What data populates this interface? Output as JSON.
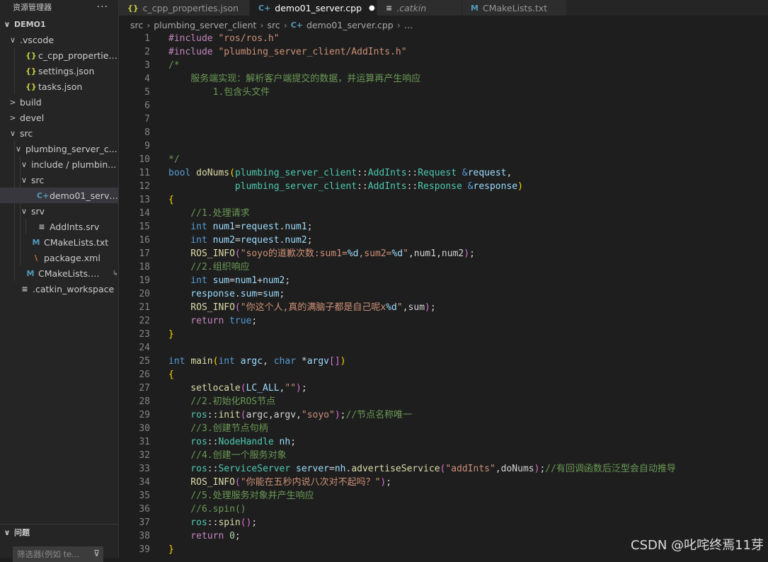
{
  "sidebar": {
    "title": "资源管理器",
    "more": "···",
    "tree": [
      {
        "label": "DEMO1",
        "indent": 0,
        "chev": "∨",
        "icon": "",
        "root": true
      },
      {
        "label": ".vscode",
        "indent": 1,
        "chev": "∨",
        "icon": ""
      },
      {
        "label": "c_cpp_properties.j...",
        "indent": 2,
        "chev": "",
        "icon": "{}",
        "icls": "json"
      },
      {
        "label": "settings.json",
        "indent": 2,
        "chev": "",
        "icon": "{}",
        "icls": "json"
      },
      {
        "label": "tasks.json",
        "indent": 2,
        "chev": "",
        "icon": "{}",
        "icls": "json"
      },
      {
        "label": "build",
        "indent": 1,
        "chev": ">",
        "icon": ""
      },
      {
        "label": "devel",
        "indent": 1,
        "chev": ">",
        "icon": ""
      },
      {
        "label": "src",
        "indent": 1,
        "chev": "∨",
        "icon": ""
      },
      {
        "label": "plumbing_server_c...",
        "indent": 2,
        "chev": "∨",
        "icon": ""
      },
      {
        "label": "include / plumbin...",
        "indent": 3,
        "chev": "∨",
        "icon": ""
      },
      {
        "label": "src",
        "indent": 3,
        "chev": "∨",
        "icon": ""
      },
      {
        "label": "demo01_server....",
        "indent": 4,
        "chev": "",
        "icon": "C+",
        "icls": "cpp",
        "selected": true
      },
      {
        "label": "srv",
        "indent": 3,
        "chev": "∨",
        "icon": ""
      },
      {
        "label": "AddInts.srv",
        "indent": 4,
        "chev": "",
        "icon": "≡",
        "icls": "txt"
      },
      {
        "label": "CMakeLists.txt",
        "indent": 3,
        "chev": "",
        "icon": "M",
        "icls": "m"
      },
      {
        "label": "package.xml",
        "indent": 3,
        "chev": "",
        "icon": "\\",
        "icls": "rss"
      },
      {
        "label": "CMakeLists.txt",
        "indent": 2,
        "chev": "",
        "icon": "M",
        "icls": "m",
        "link": "↳"
      },
      {
        "label": ".catkin_workspace",
        "indent": 1,
        "chev": "",
        "icon": "≡",
        "icls": "txt"
      }
    ]
  },
  "problems": {
    "title": "问题",
    "filter_placeholder": "筛选器(例如 te..."
  },
  "tabs": [
    {
      "label": "c_cpp_properties.json",
      "icon": "{}",
      "icolor": "#cbcb41",
      "active": false,
      "width": 185
    },
    {
      "label": "demo01_server.cpp",
      "icon": "C+",
      "icolor": "#519aba",
      "active": true,
      "modified": true,
      "width": 180
    },
    {
      "label": ".catkin",
      "icon": "≡",
      "icolor": "#c5c5c5",
      "active": false,
      "italic": true,
      "width": 120
    },
    {
      "label": "CMakeLists.txt",
      "icon": "M",
      "icolor": "#519aba",
      "active": false,
      "width": 148
    }
  ],
  "breadcrumb": [
    "src",
    "plumbing_server_client",
    "src",
    "demo01_server.cpp",
    "…"
  ],
  "editor": {
    "lines": [
      [
        [
          "#include ",
          "pre"
        ],
        [
          "\"ros/ros.h\"",
          "str"
        ]
      ],
      [
        [
          "#include ",
          "pre"
        ],
        [
          "\"plumbing_server_client/AddInts.h\"",
          "str"
        ]
      ],
      [
        [
          "/*",
          "com"
        ]
      ],
      [
        [
          "    服务端实现：解析客户端提交的数据，并运算再产生响应",
          "com"
        ]
      ],
      [
        [
          "        1.包含头文件",
          "com"
        ]
      ],
      [],
      [],
      [],
      [],
      [
        [
          "*/",
          "com"
        ]
      ],
      [
        [
          "bool ",
          "kw"
        ],
        [
          "doNums",
          "fn"
        ],
        [
          "(",
          "br"
        ],
        [
          "plumbing_server_client",
          "ty"
        ],
        [
          "::",
          "pl"
        ],
        [
          "AddInts",
          "ty"
        ],
        [
          "::",
          "pl"
        ],
        [
          "Request",
          "ty"
        ],
        [
          " &",
          "kw"
        ],
        [
          "request",
          "var"
        ],
        [
          ",",
          "pl"
        ]
      ],
      [
        [
          "            plumbing_server_client",
          "ty"
        ],
        [
          "::",
          "pl"
        ],
        [
          "AddInts",
          "ty"
        ],
        [
          "::",
          "pl"
        ],
        [
          "Response",
          "ty"
        ],
        [
          " &",
          "kw"
        ],
        [
          "response",
          "var"
        ],
        [
          ")",
          "br"
        ]
      ],
      [
        [
          "{",
          "br"
        ]
      ],
      [
        [
          "    //1.处理请求",
          "com"
        ]
      ],
      [
        [
          "    int ",
          "kw"
        ],
        [
          "num1",
          "var"
        ],
        [
          "=",
          "pl"
        ],
        [
          "request",
          "var"
        ],
        [
          ".",
          "pl"
        ],
        [
          "num1",
          "var"
        ],
        [
          ";",
          "pl"
        ]
      ],
      [
        [
          "    int ",
          "kw"
        ],
        [
          "num2",
          "var"
        ],
        [
          "=",
          "pl"
        ],
        [
          "request",
          "var"
        ],
        [
          ".",
          "pl"
        ],
        [
          "num2",
          "var"
        ],
        [
          ";",
          "pl"
        ]
      ],
      [
        [
          "    ROS_INFO",
          "fn"
        ],
        [
          "(",
          "br2"
        ],
        [
          "\"soyo的道歉次数:sum1=",
          "str"
        ],
        [
          "%d",
          "fmt"
        ],
        [
          ",sum2=",
          "str"
        ],
        [
          "%d",
          "fmt"
        ],
        [
          "\"",
          "str"
        ],
        [
          ",num1,num2",
          "pl"
        ],
        [
          ")",
          "br2"
        ],
        [
          ";",
          "pl"
        ]
      ],
      [
        [
          "    //2.组织响应",
          "com"
        ]
      ],
      [
        [
          "    int ",
          "kw"
        ],
        [
          "sum",
          "var"
        ],
        [
          "=",
          "pl"
        ],
        [
          "num1",
          "var"
        ],
        [
          "+",
          "pl"
        ],
        [
          "num2",
          "var"
        ],
        [
          ";",
          "pl"
        ]
      ],
      [
        [
          "    response",
          "var"
        ],
        [
          ".",
          "pl"
        ],
        [
          "sum",
          "var"
        ],
        [
          "=",
          "pl"
        ],
        [
          "sum",
          "var"
        ],
        [
          ";",
          "pl"
        ]
      ],
      [
        [
          "    ROS_INFO",
          "fn"
        ],
        [
          "(",
          "br2"
        ],
        [
          "\"你这个人,真的满脑子都是自己呢x",
          "str"
        ],
        [
          "%d",
          "fmt"
        ],
        [
          "\"",
          "str"
        ],
        [
          ",sum",
          "pl"
        ],
        [
          ")",
          "br2"
        ],
        [
          ";",
          "pl"
        ]
      ],
      [
        [
          "    return ",
          "pre"
        ],
        [
          "true",
          "kw"
        ],
        [
          ";",
          "pl"
        ]
      ],
      [
        [
          "}",
          "br"
        ]
      ],
      [],
      [
        [
          "int ",
          "kw"
        ],
        [
          "main",
          "fn"
        ],
        [
          "(",
          "br"
        ],
        [
          "int ",
          "kw"
        ],
        [
          "argc",
          "var"
        ],
        [
          ", ",
          "pl"
        ],
        [
          "char ",
          "kw"
        ],
        [
          "*",
          "pl"
        ],
        [
          "argv",
          "var"
        ],
        [
          "[]",
          "br2"
        ],
        [
          ")",
          "br"
        ]
      ],
      [
        [
          "{",
          "br"
        ]
      ],
      [
        [
          "    setlocale",
          "fn"
        ],
        [
          "(",
          "br2"
        ],
        [
          "LC_ALL",
          "var"
        ],
        [
          ",",
          "pl"
        ],
        [
          "\"\"",
          "str"
        ],
        [
          ")",
          "br2"
        ],
        [
          ";",
          "pl"
        ]
      ],
      [
        [
          "    //2.初始化ROS节点",
          "com"
        ]
      ],
      [
        [
          "    ros",
          "ty"
        ],
        [
          "::",
          "pl"
        ],
        [
          "init",
          "fn"
        ],
        [
          "(",
          "br2"
        ],
        [
          "argc,argv,",
          "pl"
        ],
        [
          "\"soyo\"",
          "str"
        ],
        [
          ")",
          "br2"
        ],
        [
          ";",
          "pl"
        ],
        [
          "//节点名称唯一",
          "com"
        ]
      ],
      [
        [
          "    //3.创建节点句柄",
          "com"
        ]
      ],
      [
        [
          "    ros",
          "ty"
        ],
        [
          "::",
          "pl"
        ],
        [
          "NodeHandle ",
          "ty"
        ],
        [
          "nh",
          "var"
        ],
        [
          ";",
          "pl"
        ]
      ],
      [
        [
          "    //4.创建一个服务对象",
          "com"
        ]
      ],
      [
        [
          "    ros",
          "ty"
        ],
        [
          "::",
          "pl"
        ],
        [
          "ServiceServer ",
          "ty"
        ],
        [
          "server",
          "var"
        ],
        [
          "=",
          "pl"
        ],
        [
          "nh",
          "var"
        ],
        [
          ".",
          "pl"
        ],
        [
          "advertiseService",
          "fn"
        ],
        [
          "(",
          "br2"
        ],
        [
          "\"addInts\"",
          "str"
        ],
        [
          ",doNums",
          "pl"
        ],
        [
          ")",
          "br2"
        ],
        [
          ";",
          "pl"
        ],
        [
          "//有回调函数后泛型会自动推导",
          "com"
        ]
      ],
      [
        [
          "    ROS_INFO",
          "fn"
        ],
        [
          "(",
          "br2"
        ],
        [
          "\"你能在五秒内说八次对不起吗？\"",
          "str"
        ],
        [
          ")",
          "br2"
        ],
        [
          ";",
          "pl"
        ]
      ],
      [
        [
          "    //5.处理服务对象并产生响应",
          "com"
        ]
      ],
      [
        [
          "    //6.spin()",
          "com"
        ]
      ],
      [
        [
          "    ros",
          "ty"
        ],
        [
          "::",
          "pl"
        ],
        [
          "spin",
          "fn"
        ],
        [
          "()",
          "br2"
        ],
        [
          ";",
          "pl"
        ]
      ],
      [
        [
          "    return ",
          "pre"
        ],
        [
          "0",
          "num"
        ],
        [
          ";",
          "pl"
        ]
      ],
      [
        [
          "}",
          "br"
        ]
      ]
    ]
  },
  "watermark": "CSDN @叱咤终焉11芽"
}
